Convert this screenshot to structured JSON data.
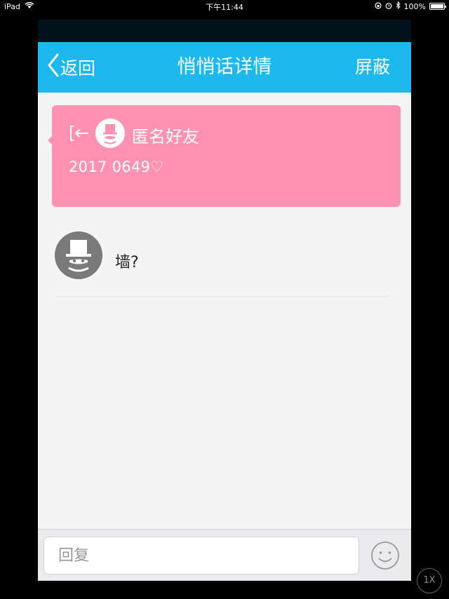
{
  "status_bar": {
    "device": "iPad",
    "time": "下午11:44",
    "battery": "100%"
  },
  "nav": {
    "back_label": "返回",
    "title": "悄悄话详情",
    "block_label": "屏蔽"
  },
  "card": {
    "sender": "匿名好友",
    "message": "2017 0649♡",
    "color": "#ff92b3"
  },
  "reply_message": {
    "text": "墙?"
  },
  "footer": {
    "reply_placeholder": "回复"
  },
  "zoom_button": {
    "label": "1X"
  },
  "colors": {
    "navbar": "#1cb8ee",
    "background": "#f4f4f5"
  }
}
